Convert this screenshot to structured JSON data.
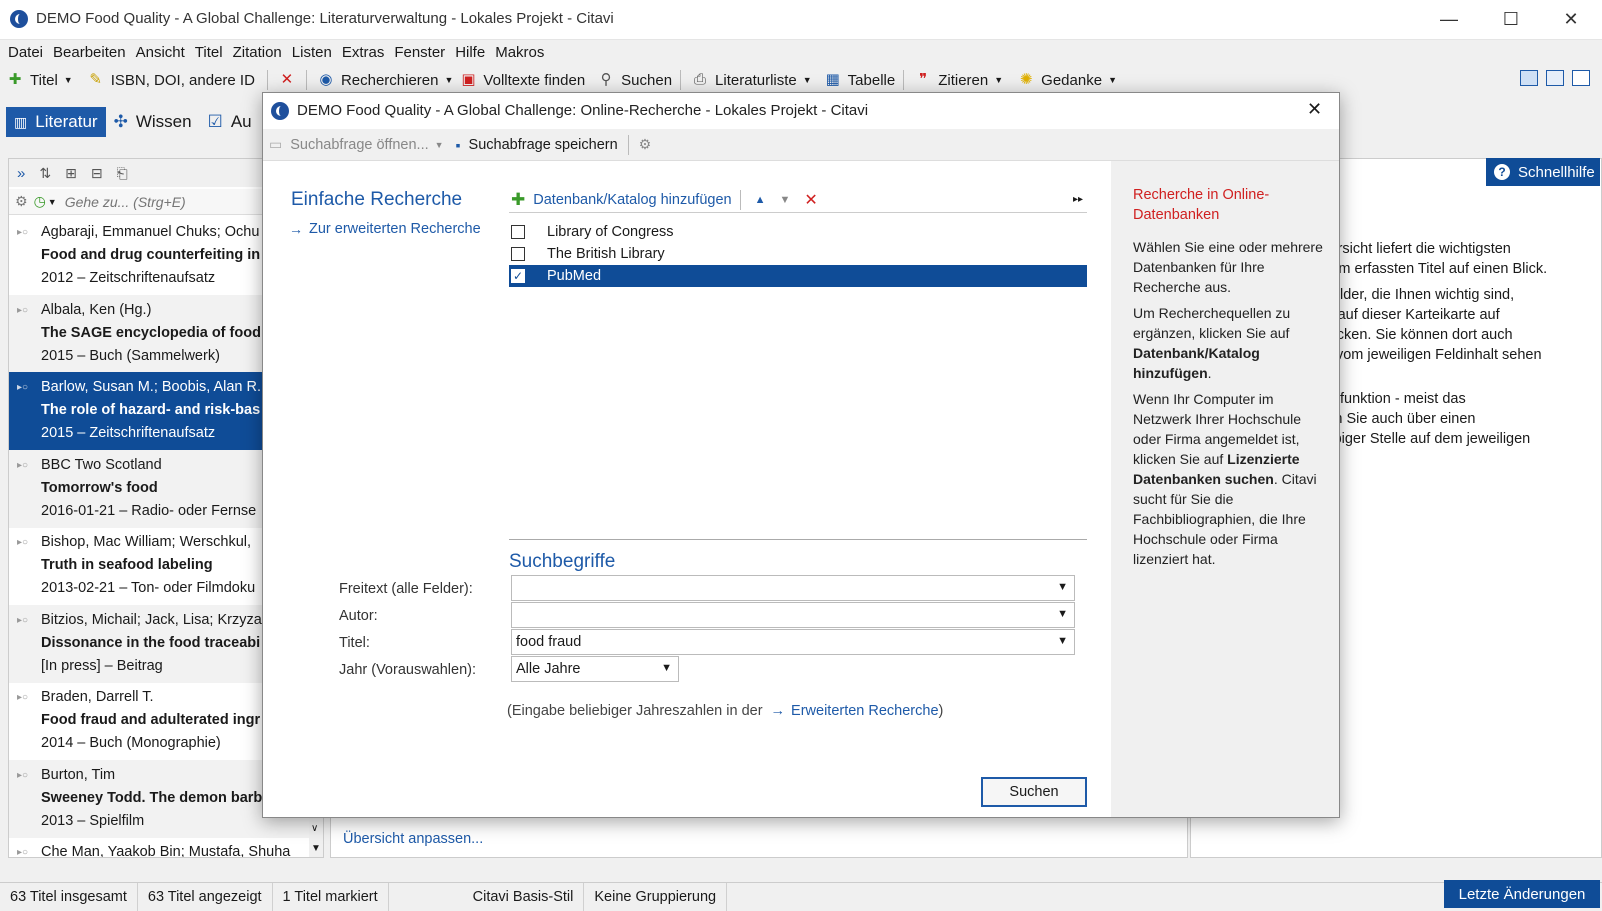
{
  "window": {
    "title": "DEMO Food Quality - A Global Challenge: Literaturverwaltung - Lokales Projekt - Citavi",
    "minimize": "—",
    "maximize": "☐",
    "close": "✕"
  },
  "menu": [
    "Datei",
    "Bearbeiten",
    "Ansicht",
    "Titel",
    "Zitation",
    "Listen",
    "Extras",
    "Fenster",
    "Hilfe",
    "Makros"
  ],
  "toolbar": {
    "titel": "Titel",
    "isbn": "ISBN, DOI, andere ID",
    "recherchieren": "Recherchieren",
    "volltexte": "Volltexte finden",
    "suchen": "Suchen",
    "literaturliste": "Literaturliste",
    "tabelle": "Tabelle",
    "zitieren": "Zitieren",
    "gedanke": "Gedanke"
  },
  "nav_tabs": [
    "Literatur",
    "Wissen",
    "Au"
  ],
  "left_pane": {
    "search_placeholder": "Gehe zu... (Strg+E)",
    "references": [
      {
        "authors": "Agbaraji, Emmanuel Chuks; Ochu",
        "title": "Food and drug counterfeiting in",
        "meta": "2012 – Zeitschriftenaufsatz"
      },
      {
        "authors": "Albala, Ken (Hg.)",
        "title": "The SAGE encyclopedia of food",
        "meta": "2015 – Buch (Sammelwerk)"
      },
      {
        "authors": "Barlow, Susan M.; Boobis, Alan R.",
        "title": "The role of hazard- and risk-bas",
        "meta": "2015 – Zeitschriftenaufsatz"
      },
      {
        "authors": "BBC Two Scotland",
        "title": "Tomorrow's food",
        "meta": "2016-01-21 – Radio- oder Fernse"
      },
      {
        "authors": "Bishop, Mac William; Werschkul,",
        "title": "Truth in seafood labeling",
        "meta": "2013-02-21 – Ton- oder Filmdoku"
      },
      {
        "authors": "Bitzios, Michail; Jack, Lisa; Krzyzar",
        "title": "Dissonance in the food traceabi",
        "meta": "[In press] – Beitrag"
      },
      {
        "authors": "Braden, Darrell T.",
        "title": "Food fraud and adulterated ingr",
        "meta": "2014 – Buch (Monographie)"
      },
      {
        "authors": "Burton, Tim",
        "title": "Sweeney Todd. The demon barb",
        "meta": "2013 – Spielfilm"
      },
      {
        "authors": "Che Man, Yaakob Bin; Mustafa, Shuha",
        "title": "",
        "meta": ""
      }
    ]
  },
  "right_pane": {
    "schnellhilfe": "Schnellhilfe",
    "lines": [
      "Übersicht liefert die wichtigsten",
      "jedem erfassten Titel auf einen Blick.",
      "e Felder, die Ihnen wichtig sind,",
      "nks auf dieser Karteikarte auf",
      "n klicken. Sie können dort auch",
      "Sie vom jeweiligen Feldinhalt sehen",
      "dardfunktion - meist das",
      "chen Sie auch über einen",
      "eliebiger Stelle auf dem jeweiligen"
    ]
  },
  "mid_pane": {
    "link": "Übersicht anpassen..."
  },
  "status": {
    "total": "63 Titel insgesamt",
    "shown": "63 Titel angezeigt",
    "marked": "1 Titel markiert",
    "style": "Citavi Basis-Stil",
    "grouping": "Keine Gruppierung",
    "letzte": "Letzte Änderungen"
  },
  "dialog": {
    "title": "DEMO Food Quality - A Global Challenge: Online-Recherche - Lokales Projekt - Citavi",
    "open_query": "Suchabfrage öffnen...",
    "save_query": "Suchabfrage speichern",
    "heading": "Einfache Recherche",
    "advanced_link": "Zur erweiterten Recherche",
    "add_db": "Datenbank/Katalog hinzufügen",
    "databases": [
      {
        "name": "Library of Congress",
        "checked": false
      },
      {
        "name": "The British Library",
        "checked": false
      },
      {
        "name": "PubMed",
        "checked": true
      }
    ],
    "terms_heading": "Suchbegriffe",
    "fields": {
      "freitext_label": "Freitext (alle Felder):",
      "freitext_value": "",
      "autor_label": "Autor:",
      "autor_value": "",
      "titel_label": "Titel:",
      "titel_value": "food fraud",
      "jahr_label": "Jahr (Vorauswahlen):",
      "jahr_value": "Alle Jahre"
    },
    "note_prefix": "(Eingabe beliebiger Jahreszahlen in der",
    "note_link": "Erweiterten Recherche",
    "note_suffix": ")",
    "search_button": "Suchen",
    "help": {
      "heading": "Recherche in Online-Datenbanken",
      "p1": "Wählen Sie eine oder mehrere Datenbanken für Ihre Recherche aus.",
      "p2a": "Um Recherchequellen zu ergänzen, klicken Sie auf",
      "p2b": "Datenbank/Katalog hinzufügen",
      "p3a": "Wenn Ihr Computer im Netzwerk Ihrer Hochschule oder Firma angemeldet ist, klicken Sie auf",
      "p3b": "Lizenzierte Datenbanken suchen",
      "p3c": "Citavi sucht für Sie die Fachbibliographien, die Ihre Hochschule oder Firma lizenziert hat."
    }
  }
}
